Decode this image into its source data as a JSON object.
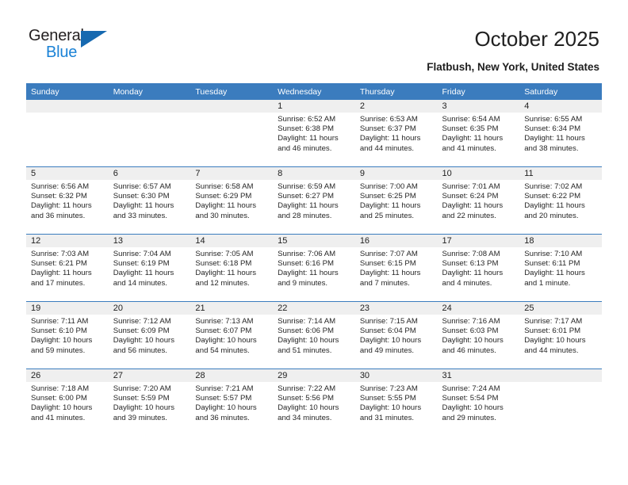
{
  "brand": {
    "name_top": "General",
    "name_bottom": "Blue",
    "color_dark": "#231f20",
    "color_blue": "#1a82d6",
    "triangle_color": "#1669b0"
  },
  "header": {
    "title": "October 2025",
    "subtitle": "Flatbush, New York, United States"
  },
  "theme": {
    "header_blue": "#3b7cbe",
    "daynum_band": "#efefef",
    "text": "#262626"
  },
  "weekday_headers": [
    "Sunday",
    "Monday",
    "Tuesday",
    "Wednesday",
    "Thursday",
    "Friday",
    "Saturday"
  ],
  "weeks": [
    [
      {
        "day": "",
        "empty": true
      },
      {
        "day": "",
        "empty": true
      },
      {
        "day": "",
        "empty": true
      },
      {
        "day": "1",
        "sunrise": "Sunrise: 6:52 AM",
        "sunset": "Sunset: 6:38 PM",
        "daylight": "Daylight: 11 hours and 46 minutes."
      },
      {
        "day": "2",
        "sunrise": "Sunrise: 6:53 AM",
        "sunset": "Sunset: 6:37 PM",
        "daylight": "Daylight: 11 hours and 44 minutes."
      },
      {
        "day": "3",
        "sunrise": "Sunrise: 6:54 AM",
        "sunset": "Sunset: 6:35 PM",
        "daylight": "Daylight: 11 hours and 41 minutes."
      },
      {
        "day": "4",
        "sunrise": "Sunrise: 6:55 AM",
        "sunset": "Sunset: 6:34 PM",
        "daylight": "Daylight: 11 hours and 38 minutes."
      }
    ],
    [
      {
        "day": "5",
        "sunrise": "Sunrise: 6:56 AM",
        "sunset": "Sunset: 6:32 PM",
        "daylight": "Daylight: 11 hours and 36 minutes."
      },
      {
        "day": "6",
        "sunrise": "Sunrise: 6:57 AM",
        "sunset": "Sunset: 6:30 PM",
        "daylight": "Daylight: 11 hours and 33 minutes."
      },
      {
        "day": "7",
        "sunrise": "Sunrise: 6:58 AM",
        "sunset": "Sunset: 6:29 PM",
        "daylight": "Daylight: 11 hours and 30 minutes."
      },
      {
        "day": "8",
        "sunrise": "Sunrise: 6:59 AM",
        "sunset": "Sunset: 6:27 PM",
        "daylight": "Daylight: 11 hours and 28 minutes."
      },
      {
        "day": "9",
        "sunrise": "Sunrise: 7:00 AM",
        "sunset": "Sunset: 6:25 PM",
        "daylight": "Daylight: 11 hours and 25 minutes."
      },
      {
        "day": "10",
        "sunrise": "Sunrise: 7:01 AM",
        "sunset": "Sunset: 6:24 PM",
        "daylight": "Daylight: 11 hours and 22 minutes."
      },
      {
        "day": "11",
        "sunrise": "Sunrise: 7:02 AM",
        "sunset": "Sunset: 6:22 PM",
        "daylight": "Daylight: 11 hours and 20 minutes."
      }
    ],
    [
      {
        "day": "12",
        "sunrise": "Sunrise: 7:03 AM",
        "sunset": "Sunset: 6:21 PM",
        "daylight": "Daylight: 11 hours and 17 minutes."
      },
      {
        "day": "13",
        "sunrise": "Sunrise: 7:04 AM",
        "sunset": "Sunset: 6:19 PM",
        "daylight": "Daylight: 11 hours and 14 minutes."
      },
      {
        "day": "14",
        "sunrise": "Sunrise: 7:05 AM",
        "sunset": "Sunset: 6:18 PM",
        "daylight": "Daylight: 11 hours and 12 minutes."
      },
      {
        "day": "15",
        "sunrise": "Sunrise: 7:06 AM",
        "sunset": "Sunset: 6:16 PM",
        "daylight": "Daylight: 11 hours and 9 minutes."
      },
      {
        "day": "16",
        "sunrise": "Sunrise: 7:07 AM",
        "sunset": "Sunset: 6:15 PM",
        "daylight": "Daylight: 11 hours and 7 minutes."
      },
      {
        "day": "17",
        "sunrise": "Sunrise: 7:08 AM",
        "sunset": "Sunset: 6:13 PM",
        "daylight": "Daylight: 11 hours and 4 minutes."
      },
      {
        "day": "18",
        "sunrise": "Sunrise: 7:10 AM",
        "sunset": "Sunset: 6:11 PM",
        "daylight": "Daylight: 11 hours and 1 minute."
      }
    ],
    [
      {
        "day": "19",
        "sunrise": "Sunrise: 7:11 AM",
        "sunset": "Sunset: 6:10 PM",
        "daylight": "Daylight: 10 hours and 59 minutes."
      },
      {
        "day": "20",
        "sunrise": "Sunrise: 7:12 AM",
        "sunset": "Sunset: 6:09 PM",
        "daylight": "Daylight: 10 hours and 56 minutes."
      },
      {
        "day": "21",
        "sunrise": "Sunrise: 7:13 AM",
        "sunset": "Sunset: 6:07 PM",
        "daylight": "Daylight: 10 hours and 54 minutes."
      },
      {
        "day": "22",
        "sunrise": "Sunrise: 7:14 AM",
        "sunset": "Sunset: 6:06 PM",
        "daylight": "Daylight: 10 hours and 51 minutes."
      },
      {
        "day": "23",
        "sunrise": "Sunrise: 7:15 AM",
        "sunset": "Sunset: 6:04 PM",
        "daylight": "Daylight: 10 hours and 49 minutes."
      },
      {
        "day": "24",
        "sunrise": "Sunrise: 7:16 AM",
        "sunset": "Sunset: 6:03 PM",
        "daylight": "Daylight: 10 hours and 46 minutes."
      },
      {
        "day": "25",
        "sunrise": "Sunrise: 7:17 AM",
        "sunset": "Sunset: 6:01 PM",
        "daylight": "Daylight: 10 hours and 44 minutes."
      }
    ],
    [
      {
        "day": "26",
        "sunrise": "Sunrise: 7:18 AM",
        "sunset": "Sunset: 6:00 PM",
        "daylight": "Daylight: 10 hours and 41 minutes."
      },
      {
        "day": "27",
        "sunrise": "Sunrise: 7:20 AM",
        "sunset": "Sunset: 5:59 PM",
        "daylight": "Daylight: 10 hours and 39 minutes."
      },
      {
        "day": "28",
        "sunrise": "Sunrise: 7:21 AM",
        "sunset": "Sunset: 5:57 PM",
        "daylight": "Daylight: 10 hours and 36 minutes."
      },
      {
        "day": "29",
        "sunrise": "Sunrise: 7:22 AM",
        "sunset": "Sunset: 5:56 PM",
        "daylight": "Daylight: 10 hours and 34 minutes."
      },
      {
        "day": "30",
        "sunrise": "Sunrise: 7:23 AM",
        "sunset": "Sunset: 5:55 PM",
        "daylight": "Daylight: 10 hours and 31 minutes."
      },
      {
        "day": "31",
        "sunrise": "Sunrise: 7:24 AM",
        "sunset": "Sunset: 5:54 PM",
        "daylight": "Daylight: 10 hours and 29 minutes."
      },
      {
        "day": "",
        "empty": true
      }
    ]
  ]
}
